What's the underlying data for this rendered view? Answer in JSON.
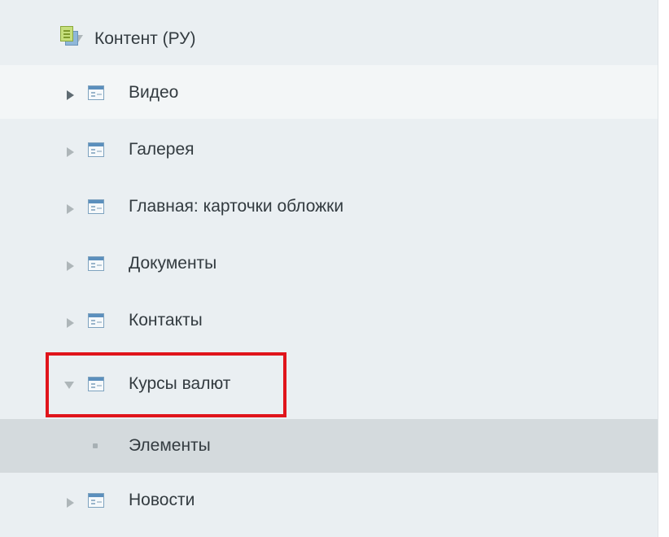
{
  "tree": {
    "root": {
      "label": "Контент (РУ)",
      "icon": "doc-folder-icon",
      "expanded": true
    },
    "items": [
      {
        "label": "Видео",
        "icon": "infoblock-icon",
        "expanded": false
      },
      {
        "label": "Галерея",
        "icon": "infoblock-icon",
        "expanded": false
      },
      {
        "label": "Главная: карточки обложки",
        "icon": "infoblock-icon",
        "expanded": false
      },
      {
        "label": "Документы",
        "icon": "infoblock-icon",
        "expanded": false
      },
      {
        "label": "Контакты",
        "icon": "infoblock-icon",
        "expanded": false
      },
      {
        "label": "Курсы валют",
        "icon": "infoblock-icon",
        "expanded": true,
        "highlighted": true,
        "children": [
          {
            "label": "Элементы",
            "icon": "bullet-icon",
            "selected": true
          }
        ]
      },
      {
        "label": "Новости",
        "icon": "infoblock-icon",
        "expanded": false
      }
    ]
  },
  "colors": {
    "panel_bg": "#eaeff2",
    "hover_row_bg": "#f3f6f7",
    "selected_row_bg": "#d4dadd",
    "highlight_border": "#e0141b"
  }
}
